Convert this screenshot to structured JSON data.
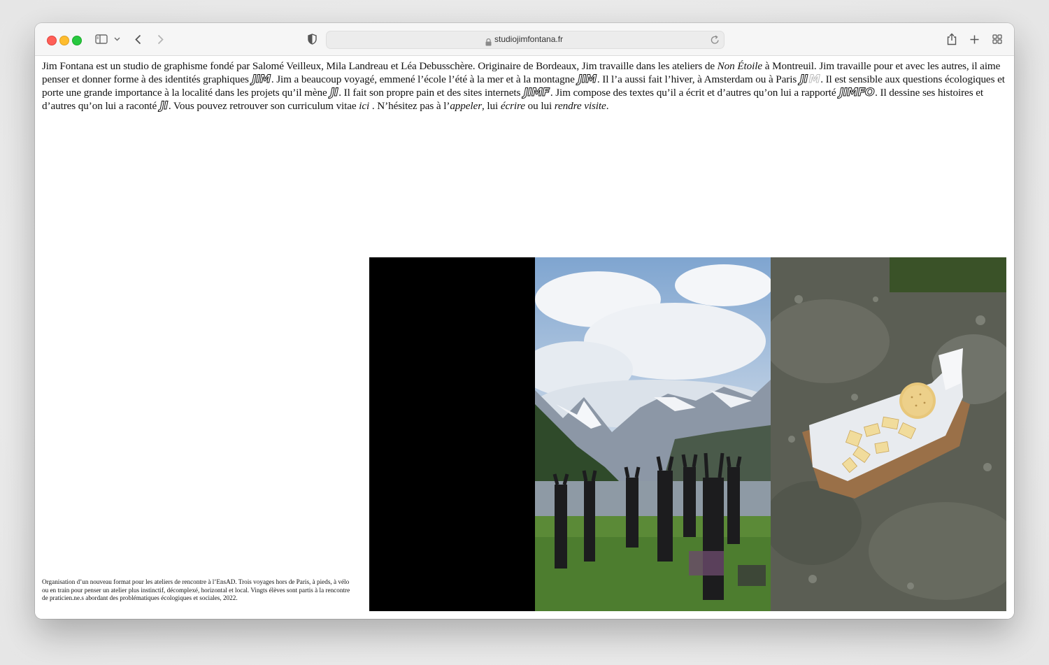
{
  "browser": {
    "url": "studiojimfontana.fr"
  },
  "intro": {
    "s1": "Jim Fontana est un studio de graphisme fondé par Salomé Veilleux, Mila Landreau et Léa Debusschère. Originaire de Bordeaux, Jim travaille dans les ateliers de ",
    "s1_italic": "Non Étoile",
    "s2": " à Montreuil. Jim travaille pour et avec les autres, il aime penser et donner forme à des identités graphiques ",
    "logo1": "JIM",
    "s3": ". Jim a beaucoup voyagé, emmené l’école l’été à la mer et à la montagne ",
    "logo2": "JIM",
    "s4": ". Il l’a aussi fait l’hiver, à Amsterdam ou à Paris ",
    "logo3a": "JI",
    "logo3b": "M",
    "s5": ". Il est sensible aux questions écologiques et porte une grande importance à la localité dans les projets qu’il mène ",
    "logo4": "JI",
    "s6": ". Il fait son propre pain et des sites internets ",
    "logo5": "JIMF",
    "s7": ". Jim compose des textes qu’il a écrit et d’autres qu’on lui a rapporté ",
    "logo6": "JIMFO",
    "s8": ". Il dessine ses histoires et d’autres qu’on lui a raconté ",
    "logo7": "JI",
    "s9": ". Vous pouvez retrouver son curriculum vitae ",
    "link_cv": "ici",
    "s10": " . N’hésitez pas à l’",
    "link_call": "appeler",
    "s11": ", lui ",
    "link_write": "écrire",
    "s12": " ou lui ",
    "link_visit": "rendre visite",
    "s13": "."
  },
  "caption": "Organisation d’un nouveau format pour les ateliers de rencontre à l’EnsAD. Trois voyages hors de Paris, à pieds, à vélo ou en train pour penser un atelier plus instinctif, décomplexé, horizontal et local. Vingts élèves sont partis à la rencontre de praticien.ne.s abordant des problématiques écologiques et sociales, 2022.",
  "colors": {
    "traffic_red": "#ff5f57",
    "traffic_yellow": "#febc2e",
    "traffic_green": "#28c840",
    "text": "#111111"
  }
}
